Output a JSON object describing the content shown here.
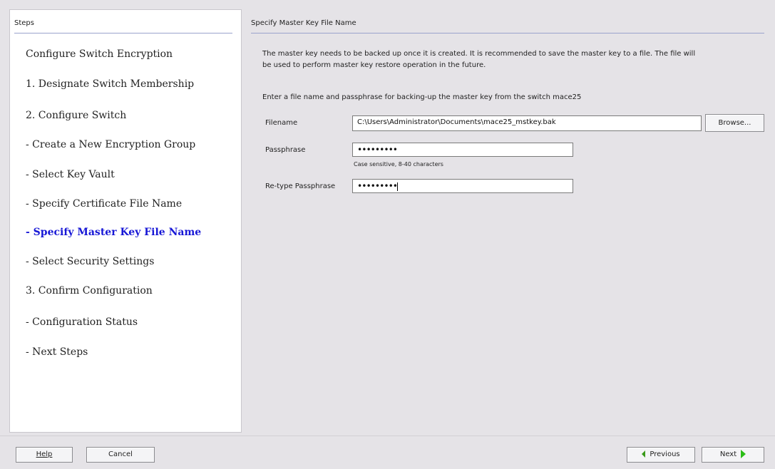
{
  "steps_panel": {
    "header": "Steps",
    "items": [
      {
        "label": "Configure Switch Encryption",
        "active": false
      },
      {
        "label": "1. Designate Switch Membership",
        "active": false
      },
      {
        "label": "2. Configure Switch",
        "active": false
      },
      {
        "label": "- Create a New Encryption Group",
        "active": false
      },
      {
        "label": "- Select Key Vault",
        "active": false
      },
      {
        "label": "- Specify Certificate File Name",
        "active": false
      },
      {
        "label": "- Specify Master Key File Name",
        "active": true
      },
      {
        "label": "- Select Security Settings",
        "active": false
      },
      {
        "label": "3. Confirm Configuration",
        "active": false
      },
      {
        "label": "- Configuration Status",
        "active": false
      },
      {
        "label": "- Next Steps",
        "active": false
      }
    ]
  },
  "main": {
    "header": "Specify Master Key File Name",
    "intro_line1": "The master key needs to be backed up once it is created. It is recommended to save the master key to a file. The file will",
    "intro_line2": "be used to perform master key restore operation in the future.",
    "instruction": "Enter a file name and passphrase for backing-up the master key from the switch mace25",
    "filename": {
      "label": "Filename",
      "value": "C:\\Users\\Administrator\\Documents\\mace25_mstkey.bak"
    },
    "browse_button": "Browse...",
    "passphrase": {
      "label": "Passphrase",
      "value": "•••••••••",
      "hint": "Case sensitive, 8-40 characters"
    },
    "retype_passphrase": {
      "label": "Re-type Passphrase",
      "value": "•••••••••"
    }
  },
  "footer": {
    "help_button": "Help",
    "cancel_button": "Cancel",
    "previous_button": "Previous",
    "next_button": "Next"
  },
  "colors": {
    "active_step": "#1717d6",
    "nav_arrow": "#2bbd16"
  }
}
